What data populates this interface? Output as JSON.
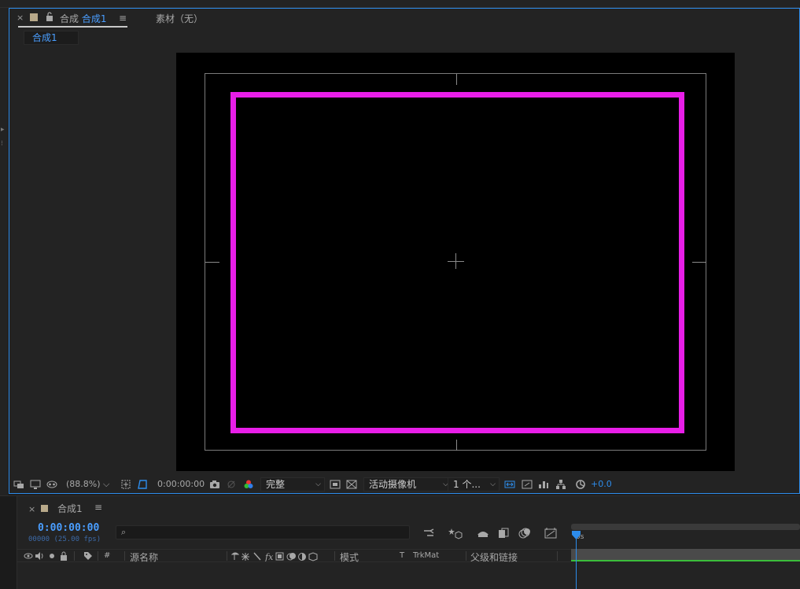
{
  "comp_panel": {
    "tab": {
      "close": "×",
      "label_prefix": "合成",
      "label_name": "合成1",
      "menu": "≡"
    },
    "footage_tab": {
      "label": "素材（无）"
    },
    "sub_tab": {
      "label": "合成1"
    }
  },
  "viewer": {
    "frame_color": "#e81ee8",
    "background": "#000000"
  },
  "viewer_toolbar": {
    "zoom": "(88.8%)",
    "timecode": "0:00:00:00",
    "resolution": "完整",
    "camera": "活动摄像机",
    "views": "1 个...",
    "exposure": "+0.0"
  },
  "timeline": {
    "tab_close": "×",
    "tab_name": "合成1",
    "menu": "≡",
    "timecode": "0:00:00:00",
    "fps_line": "00000 (25.00 fps)",
    "search_icon": "⌕",
    "ruler_label": "0s",
    "columns": {
      "hash": "#",
      "source_name": "源名称",
      "mode": "模式",
      "t": "T",
      "trkmat": "TrkMat",
      "parent": "父级和链接"
    }
  }
}
